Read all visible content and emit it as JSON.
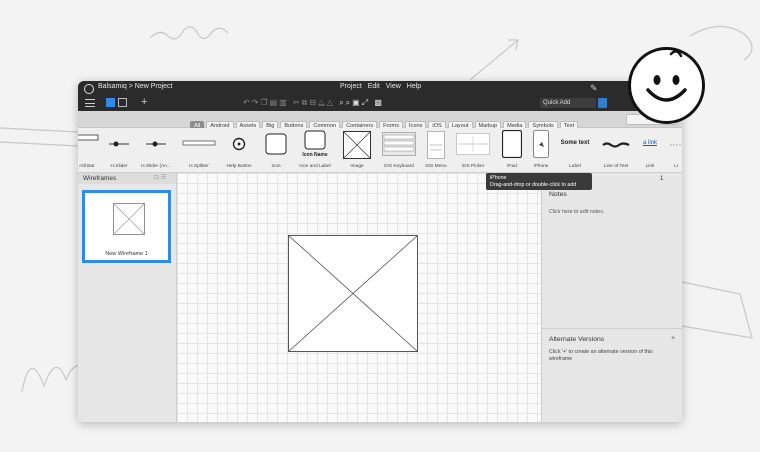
{
  "titlebar": {
    "breadcrumb": "Balsamiq > New Project",
    "menus": [
      "Project",
      "Edit",
      "View",
      "Help"
    ],
    "quick_add_placeholder": "Quick Add"
  },
  "filters": {
    "tabs": [
      "All",
      "Android",
      "Assets",
      "Big",
      "Buttons",
      "Common",
      "Containers",
      "Forms",
      "Icons",
      "iOS",
      "Layout",
      "Markup",
      "Media",
      "Symbols",
      "Text"
    ],
    "active_tab": "All",
    "more": "More"
  },
  "library": {
    "items": [
      {
        "label": "roll Bar",
        "icon": "scrollbar-icon"
      },
      {
        "label": "H.Slider",
        "icon": "h-slider-icon"
      },
      {
        "label": "H.Slider (An...",
        "icon": "h-slider-android-icon"
      },
      {
        "label": "H.Splitter",
        "icon": "h-splitter-icon"
      },
      {
        "label": "Help Button",
        "icon": "help-button-icon"
      },
      {
        "label": "Icon",
        "icon": "icon-placeholder-icon"
      },
      {
        "label": "Icon and Label",
        "icon": "icon-and-label-icon",
        "inner": "Icon Name"
      },
      {
        "label": "Image",
        "icon": "image-placeholder-icon"
      },
      {
        "label": "iOS Keyboard",
        "icon": "ios-keyboard-icon"
      },
      {
        "label": "iOS Menu",
        "icon": "ios-menu-icon"
      },
      {
        "label": "iOS Picker",
        "icon": "ios-picker-icon"
      },
      {
        "label": "iPad",
        "icon": "ipad-icon"
      },
      {
        "label": "iPhone",
        "icon": "iphone-icon"
      },
      {
        "label": "Label",
        "icon": "label-icon",
        "inner": "Some text"
      },
      {
        "label": "Line of Text",
        "icon": "line-of-text-icon"
      },
      {
        "label": "Link",
        "icon": "link-icon",
        "inner": "a link"
      },
      {
        "label": "Li",
        "icon": "list-icon"
      }
    ]
  },
  "tooltip": {
    "title": "iPhone",
    "text": "Drag-and-drop or double-click to add"
  },
  "wireframes": {
    "title": "Wireframes",
    "items": [
      {
        "label": "New Wireframe 1"
      }
    ]
  },
  "notes": {
    "header_suffix": "1",
    "title": "Notes",
    "placeholder": "Click here to edit notes."
  },
  "alternate": {
    "title": "Alternate Versions",
    "add": "+",
    "text": "Click '+' to create an alternate version of this wireframe"
  },
  "colors": {
    "accent": "#2f8be6",
    "titlebar": "#2b2b2b"
  }
}
